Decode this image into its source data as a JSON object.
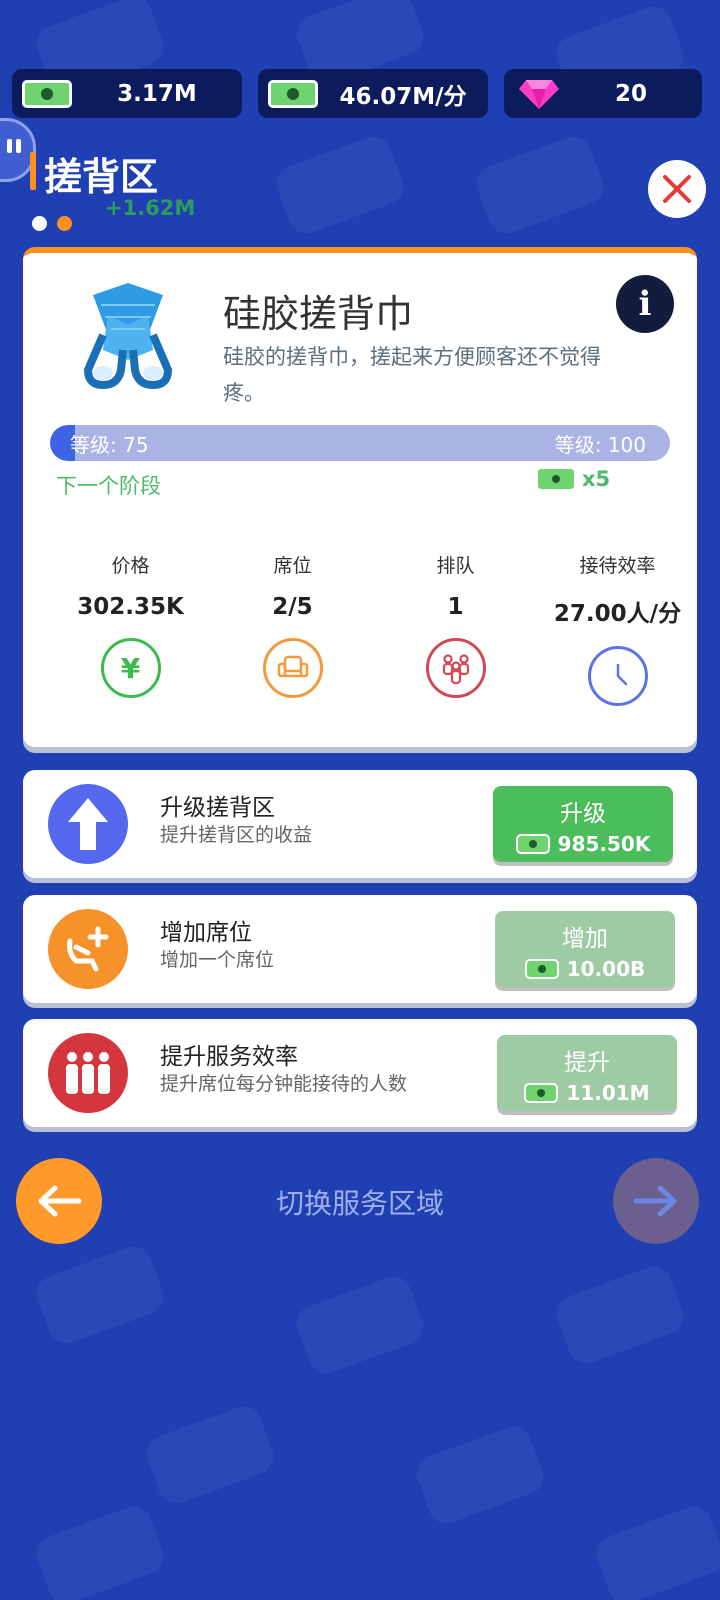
{
  "currency": {
    "cash": "3.17M",
    "rate": "46.07M/分",
    "gems": "20"
  },
  "header": {
    "title": "搓背区",
    "gain": "+1.62M"
  },
  "item": {
    "name": "硅胶搓背巾",
    "description": "硅胶的搓背巾，搓起来方便顾客还不觉得疼。",
    "level_current_label": "等级: 75",
    "level_max_label": "等级: 100",
    "level_progress_fraction": 0.04,
    "next_stage_label": "下一个阶段",
    "next_stage_multiplier": "x5"
  },
  "stats": [
    {
      "label": "价格",
      "value": "302.35K",
      "icon": "yen-icon",
      "color": "#3dbb4f"
    },
    {
      "label": "席位",
      "value": "2/5",
      "icon": "armchair-icon",
      "color": "#f39a3c"
    },
    {
      "label": "排队",
      "value": "1",
      "icon": "queue-people-icon",
      "color": "#d14a55"
    },
    {
      "label": "接待效率",
      "value": "27.00人/分",
      "icon": "clock-icon",
      "color": "#5d72e6"
    }
  ],
  "upgrades": [
    {
      "title": "升级搓背区",
      "subtitle": "提升搓背区的收益",
      "button_label": "升级",
      "cost": "985.50K",
      "enabled": true
    },
    {
      "title": "增加席位",
      "subtitle": "增加一个席位",
      "button_label": "增加",
      "cost": "10.00B",
      "enabled": false
    },
    {
      "title": "提升服务效率",
      "subtitle": "提升席位每分钟能接待的人数",
      "button_label": "提升",
      "cost": "11.01M",
      "enabled": false
    }
  ],
  "navigation": {
    "switch_label": "切换服务区域"
  },
  "colors": {
    "background": "#1f3fb3",
    "accent_orange": "#ff8f1f",
    "green_button": "#4cbd5c",
    "disabled_button": "#9fcba4"
  }
}
